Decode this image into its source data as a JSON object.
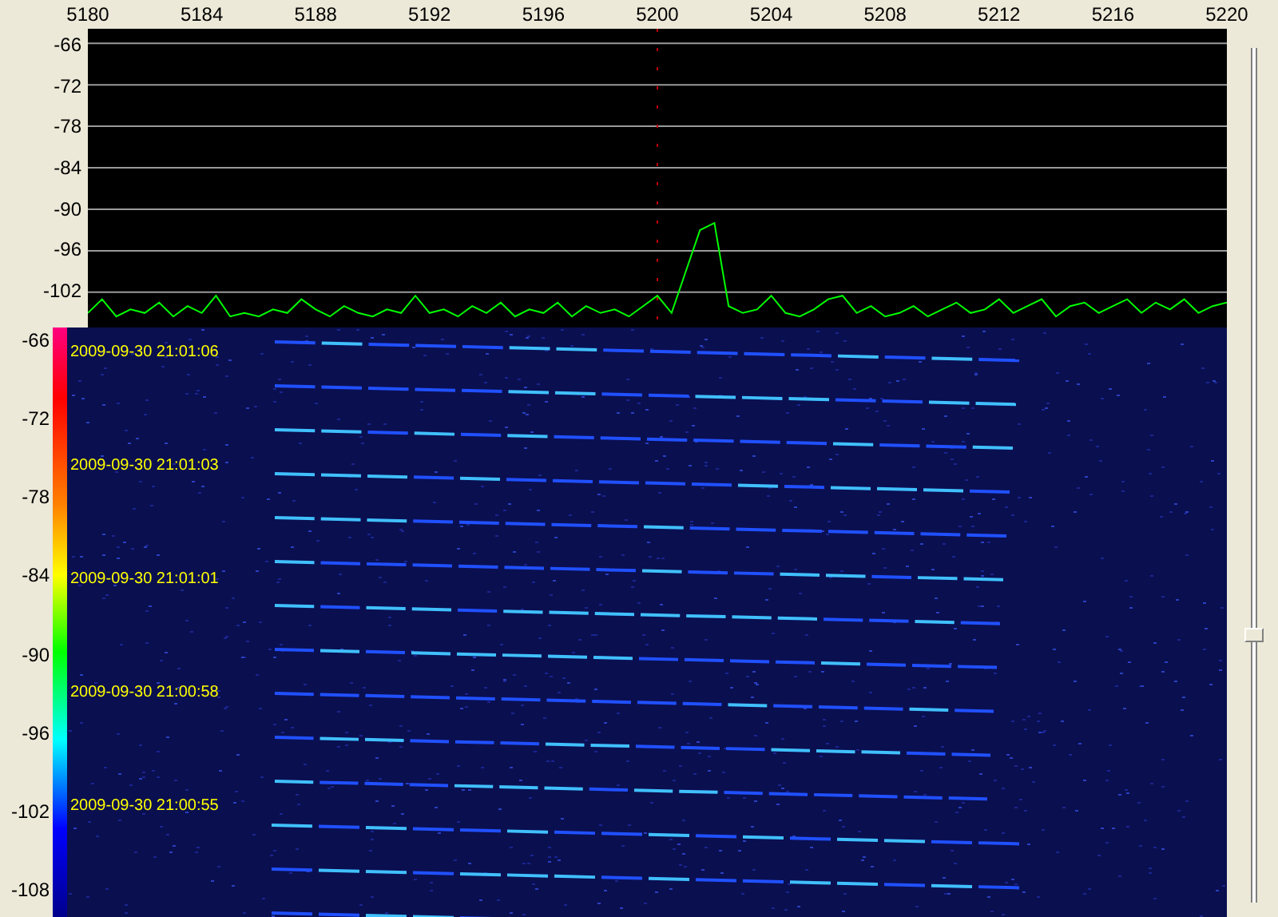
{
  "spectrum": {
    "chart_data": {
      "type": "line",
      "xlim": [
        5180,
        5220
      ],
      "ylim": [
        -107.1,
        -63.9
      ],
      "xticks": [
        5180,
        5184,
        5188,
        5192,
        5196,
        5200,
        5204,
        5208,
        5212,
        5216,
        5220
      ],
      "yticks": [
        -66,
        -72,
        -78,
        -84,
        -90,
        -96,
        -102
      ],
      "grid": true,
      "ref_lines": [
        {
          "axis": "x",
          "value": 5200,
          "color": "#c00000"
        }
      ],
      "x": [
        5180,
        5180.5,
        5181,
        5181.5,
        5182,
        5182.5,
        5183,
        5183.5,
        5184,
        5184.5,
        5185,
        5185.5,
        5186,
        5186.5,
        5187,
        5187.5,
        5188,
        5188.5,
        5189,
        5189.5,
        5190,
        5190.5,
        5191,
        5191.5,
        5192,
        5192.5,
        5193,
        5193.5,
        5194,
        5194.5,
        5195,
        5195.5,
        5196,
        5196.5,
        5197,
        5197.5,
        5198,
        5198.5,
        5199,
        5199.5,
        5200,
        5200.5,
        5201,
        5201.5,
        5202,
        5202.5,
        5203,
        5203.5,
        5204,
        5204.5,
        5205,
        5205.5,
        5206,
        5206.5,
        5207,
        5207.5,
        5208,
        5208.5,
        5209,
        5209.5,
        5210,
        5210.5,
        5211,
        5211.5,
        5212,
        5212.5,
        5213,
        5213.5,
        5214,
        5214.5,
        5215,
        5215.5,
        5216,
        5216.5,
        5217,
        5217.5,
        5218,
        5218.5,
        5219,
        5219.5,
        5220
      ],
      "series": [
        {
          "color": "#00ff00",
          "values": [
            -105,
            -103,
            -105.5,
            -104.5,
            -105,
            -103.5,
            -105.5,
            -104,
            -105,
            -102.5,
            -105.5,
            -105,
            -105.5,
            -104.5,
            -105,
            -103,
            -104.5,
            -105.5,
            -104,
            -105,
            -105.5,
            -104.5,
            -105,
            -102.5,
            -105,
            -104.5,
            -105.5,
            -104,
            -105,
            -103.5,
            -105.5,
            -104.5,
            -105,
            -103.5,
            -105.5,
            -104,
            -105,
            -104.5,
            -105.5,
            -104,
            -102.5,
            -105,
            -99,
            -93,
            -92,
            -104,
            -105,
            -104.5,
            -102.5,
            -105,
            -105.5,
            -104.5,
            -103,
            -102.5,
            -105,
            -104,
            -105.5,
            -105,
            -104,
            -105.5,
            -104.5,
            -103.5,
            -105,
            -104.5,
            -103,
            -105,
            -104,
            -103,
            -105.5,
            -104,
            -103.5,
            -105,
            -104,
            -103,
            -105,
            -103.5,
            -104.5,
            -103,
            -105,
            -104,
            -103.5
          ]
        }
      ]
    }
  },
  "waterfall": {
    "scale_labels": [
      "-66",
      "-72",
      "-78",
      "-84",
      "-90",
      "-96",
      "-102",
      "-108"
    ],
    "timestamps": [
      "2009-09-30 21:01:06",
      "2009-09-30 21:01:03",
      "2009-09-30 21:01:01",
      "2009-09-30 21:00:58",
      "2009-09-30 21:00:55"
    ]
  },
  "slider": {
    "level": 0.31
  }
}
